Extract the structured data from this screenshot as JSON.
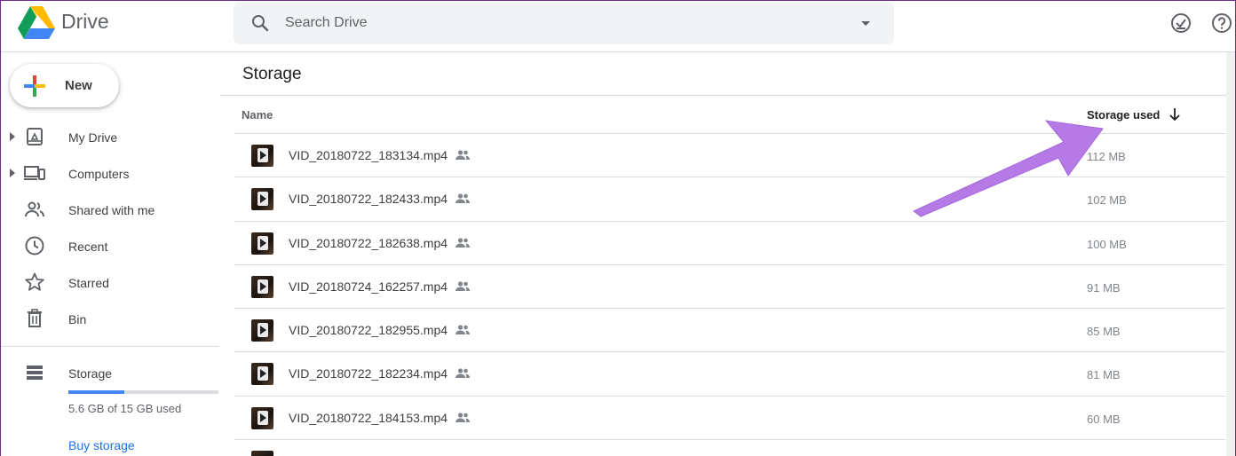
{
  "app": {
    "title": "Drive"
  },
  "search": {
    "placeholder": "Search Drive"
  },
  "sidebar": {
    "new_label": "New",
    "items": [
      {
        "label": "My Drive",
        "icon": "my-drive-icon",
        "expandable": true
      },
      {
        "label": "Computers",
        "icon": "computers-icon",
        "expandable": true
      },
      {
        "label": "Shared with me",
        "icon": "shared-with-me-icon",
        "expandable": false
      },
      {
        "label": "Recent",
        "icon": "clock-icon",
        "expandable": false
      },
      {
        "label": "Starred",
        "icon": "star-icon",
        "expandable": false
      },
      {
        "label": "Bin",
        "icon": "trash-icon",
        "expandable": false
      }
    ],
    "storage": {
      "label": "Storage",
      "usage_text": "5.6 GB of 15 GB used",
      "usage_fraction": 0.373,
      "buy_label": "Buy storage"
    }
  },
  "main": {
    "title": "Storage",
    "columns": {
      "name": "Name",
      "size": "Storage used"
    },
    "files": [
      {
        "name": "VID_20180722_183134.mp4",
        "size": "112 MB"
      },
      {
        "name": "VID_20180722_182433.mp4",
        "size": "102 MB"
      },
      {
        "name": "VID_20180722_182638.mp4",
        "size": "100 MB"
      },
      {
        "name": "VID_20180724_162257.mp4",
        "size": "91 MB"
      },
      {
        "name": "VID_20180722_182955.mp4",
        "size": "85 MB"
      },
      {
        "name": "VID_20180722_182234.mp4",
        "size": "81 MB"
      },
      {
        "name": "VID_20180722_184153.mp4",
        "size": "60 MB"
      }
    ]
  },
  "colors": {
    "accent": "#1a73e8",
    "annotation_arrow": "#b57ae6"
  }
}
